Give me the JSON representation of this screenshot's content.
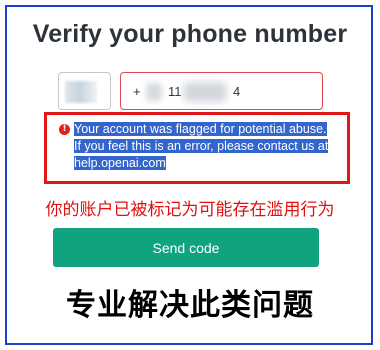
{
  "page": {
    "title": "Verify your phone number"
  },
  "phone": {
    "prefix": "+",
    "visible_digits": "11",
    "last_digit": "4"
  },
  "error": {
    "line1": "Your account was flagged for potential abuse.",
    "line2": "If you feel this is an error, please contact us at",
    "line3": "help.openai.com"
  },
  "annotations": {
    "red_note": "你的账户已被标记为可能存在滥用行为",
    "bottom_caption": "专业解决此类问题"
  },
  "actions": {
    "send_code": "Send code"
  },
  "colors": {
    "accent": "#10a37f",
    "error": "#e02020",
    "highlight": "#3366cc",
    "frame": "#1d3fd0"
  }
}
